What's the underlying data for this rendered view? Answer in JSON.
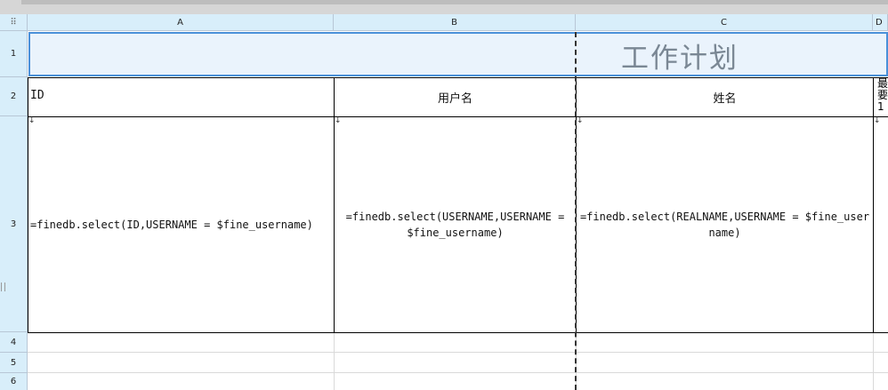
{
  "columns": [
    "A",
    "B",
    "C",
    "D"
  ],
  "rows": [
    "1",
    "2",
    "3",
    "4",
    "5",
    "6"
  ],
  "title": "工作计划",
  "headers": {
    "a": "ID",
    "b": "用户名",
    "c": "姓名",
    "d_fragment": "最要1"
  },
  "formulas": {
    "a": "=finedb.select(ID,USERNAME = $fine_username)",
    "b": "=finedb.select(USERNAME,USERNAME = $fine_username)",
    "c": "=finedb.select(REALNAME,USERNAME = $fine_username)"
  },
  "arrow_glyph": "↓",
  "grip_glyph": "⠿"
}
